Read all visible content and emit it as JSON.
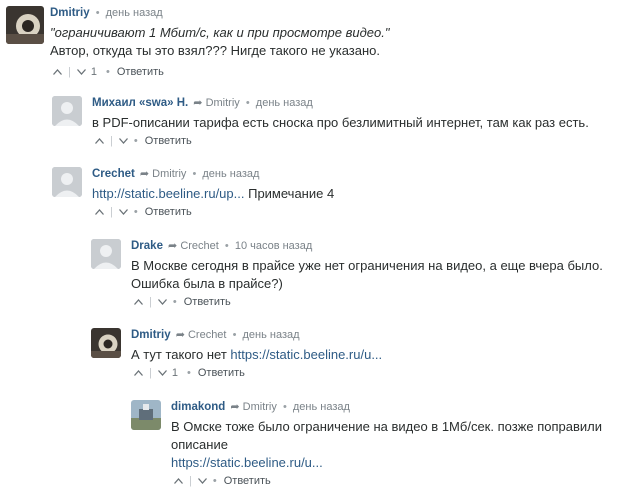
{
  "comments": [
    {
      "author": "Dmitriy",
      "reply_to": "",
      "time": "день назад",
      "lines": [
        "\"ограничивают 1 Мбит/с, как и при просмотре видео.\"",
        "Автор, откуда ты это взял??? Нигде такого не указано."
      ],
      "link": "",
      "suffix": "",
      "votes": "1",
      "reply_label": "Ответить",
      "avatar": "photo"
    },
    {
      "author": "Михаил «swa» Н.",
      "reply_to": "Dmitriy",
      "time": "день назад",
      "lines": [
        "в PDF-описании тарифа есть сноска про безлимитный интернет, там как раз есть."
      ],
      "link": "",
      "suffix": "",
      "votes": "",
      "reply_label": "Ответить",
      "avatar": "default"
    },
    {
      "author": "Crechet",
      "reply_to": "Dmitriy",
      "time": "день назад",
      "lines": [],
      "link": "http://static.beeline.ru/up...",
      "suffix": " Примечание 4",
      "votes": "",
      "reply_label": "Ответить",
      "avatar": "default"
    },
    {
      "author": "Drake",
      "reply_to": "Crechet",
      "time": "10 часов назад",
      "lines": [
        "В Москве сегодня в прайсе уже нет ограничения на видео, а еще вчера было. Ошибка была в прайсе?)"
      ],
      "link": "",
      "suffix": "",
      "votes": "",
      "reply_label": "Ответить",
      "avatar": "default"
    },
    {
      "author": "Dmitriy",
      "reply_to": "Crechet",
      "time": "день назад",
      "lines": [],
      "prefix": "А тут такого нет ",
      "link": "https://static.beeline.ru/u...",
      "suffix": "",
      "votes": "1",
      "reply_label": "Ответить",
      "avatar": "photo"
    },
    {
      "author": "dimakond",
      "reply_to": "Dmitriy",
      "time": "день назад",
      "lines": [
        "В Омске тоже было ограничение на видео в 1Мб/сек. позже поправили описание"
      ],
      "link": "https://static.beeline.ru/u...",
      "suffix": "",
      "votes": "",
      "reply_label": "Ответить",
      "avatar": "photo2"
    }
  ],
  "ui": {
    "reply_arrow_glyph": "➦",
    "separator_dot": "•",
    "accent_color": "#2e5b85"
  }
}
